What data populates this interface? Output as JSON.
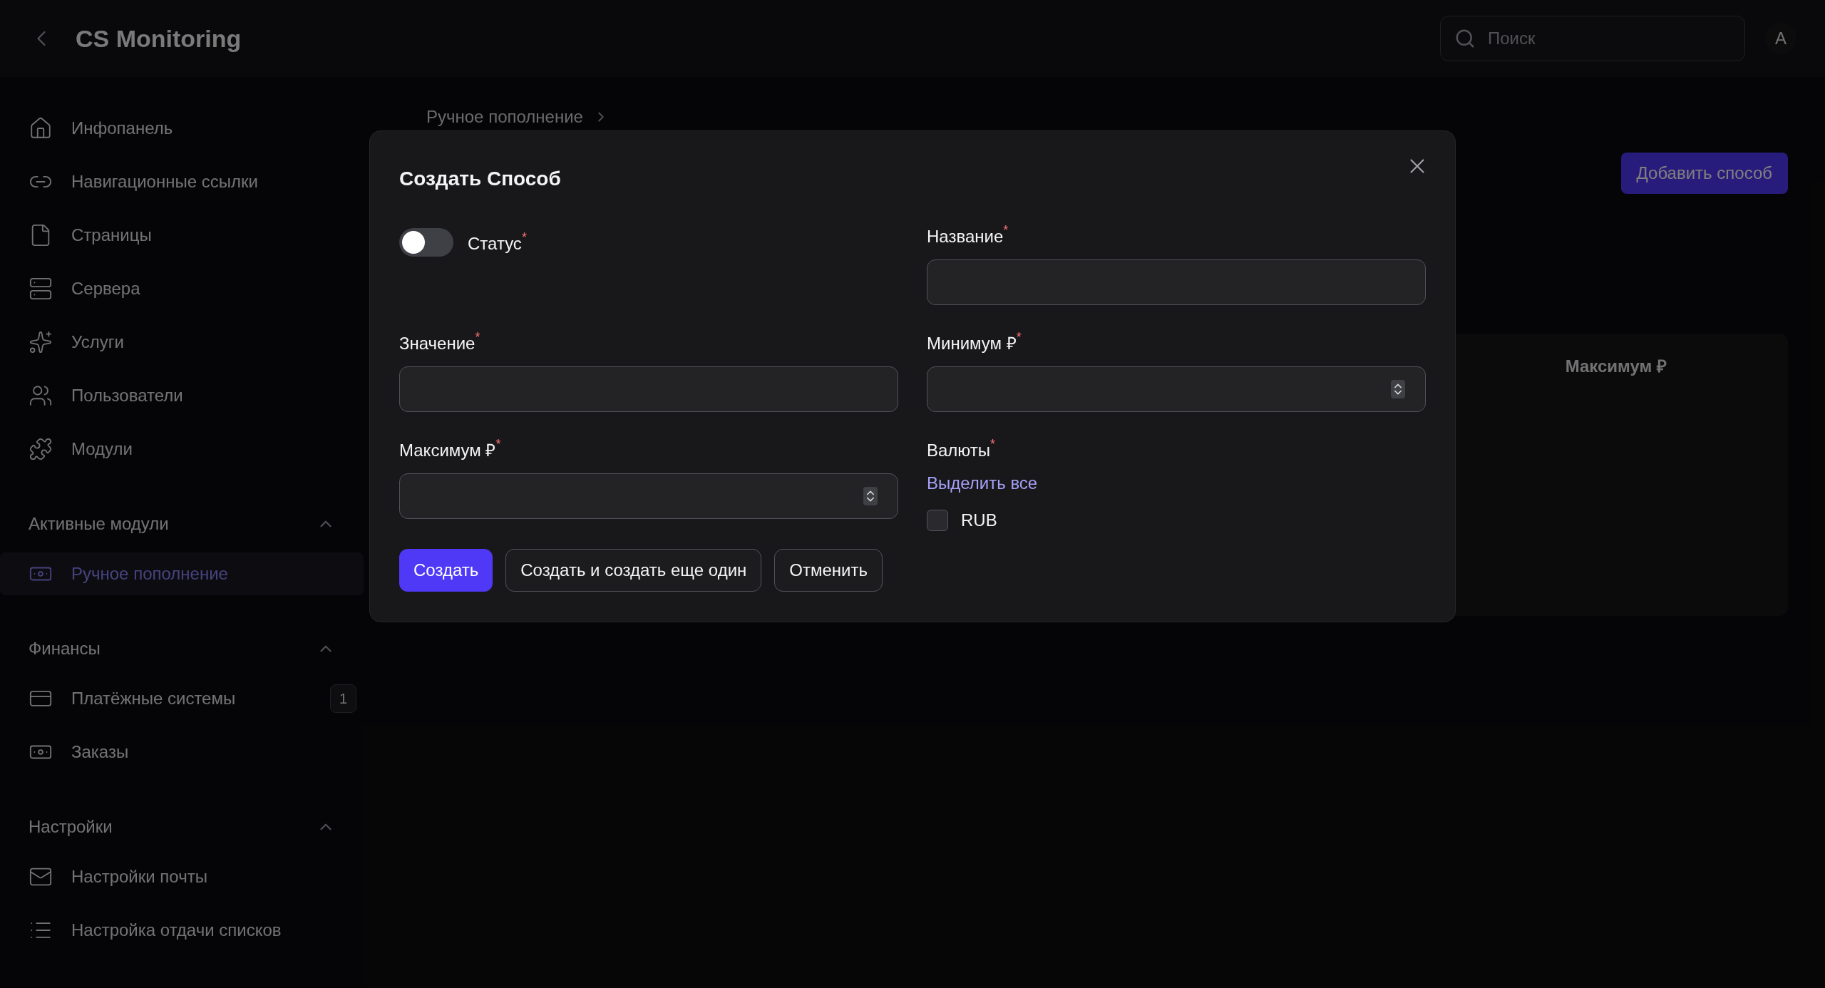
{
  "header": {
    "title": "CS Monitoring",
    "search": {
      "placeholder": "Поиск"
    },
    "avatar": "A"
  },
  "sidebar": {
    "items": [
      {
        "label": "Инфопанель",
        "selected": false
      },
      {
        "label": "Навигационные ссылки",
        "selected": false
      },
      {
        "label": "Страницы",
        "selected": false
      },
      {
        "label": "Сервера",
        "selected": false
      },
      {
        "label": "Услуги",
        "selected": false
      },
      {
        "label": "Пользователи",
        "selected": false
      },
      {
        "label": "Модули",
        "selected": false
      }
    ],
    "groups": [
      {
        "title": "Активные модули",
        "expanded": true,
        "items": [
          {
            "label": "Ручное пополнение",
            "selected": true
          }
        ]
      },
      {
        "title": "Финансы",
        "expanded": true,
        "items": [
          {
            "label": "Платёжные системы",
            "selected": false,
            "badge": "1"
          },
          {
            "label": "Заказы",
            "selected": false
          }
        ]
      },
      {
        "title": "Настройки",
        "expanded": true,
        "items": [
          {
            "label": "Настройки почты",
            "selected": false
          },
          {
            "label": "Настройка отдачи списков",
            "selected": false
          }
        ]
      }
    ]
  },
  "main": {
    "breadcrumb": "Ручное пополнение",
    "add_button": "Добавить способ",
    "table": {
      "columns": [
        "Максимум ₽"
      ]
    }
  },
  "modal": {
    "title": "Создать Способ",
    "fields": [
      {
        "kind": "toggle",
        "label": "Статус",
        "required_mark": "*",
        "on": false
      },
      {
        "kind": "text",
        "label": "Название",
        "required_mark": "*"
      },
      {
        "kind": "text",
        "label": "Значение",
        "required_mark": "*"
      },
      {
        "kind": "number",
        "label": "Минимум ₽",
        "required_mark": "*"
      },
      {
        "kind": "number",
        "label": "Максимум ₽",
        "required_mark": "*"
      },
      {
        "kind": "checkboxes",
        "label": "Валюты",
        "required_mark": "*",
        "select_all": "Выделить все",
        "options": [
          {
            "label": "RUB",
            "checked": false
          }
        ]
      }
    ],
    "buttons": [
      {
        "label": "Создать",
        "primary": true
      },
      {
        "label": "Создать и создать еще один",
        "primary": false
      },
      {
        "label": "Отменить",
        "primary": false
      }
    ]
  }
}
